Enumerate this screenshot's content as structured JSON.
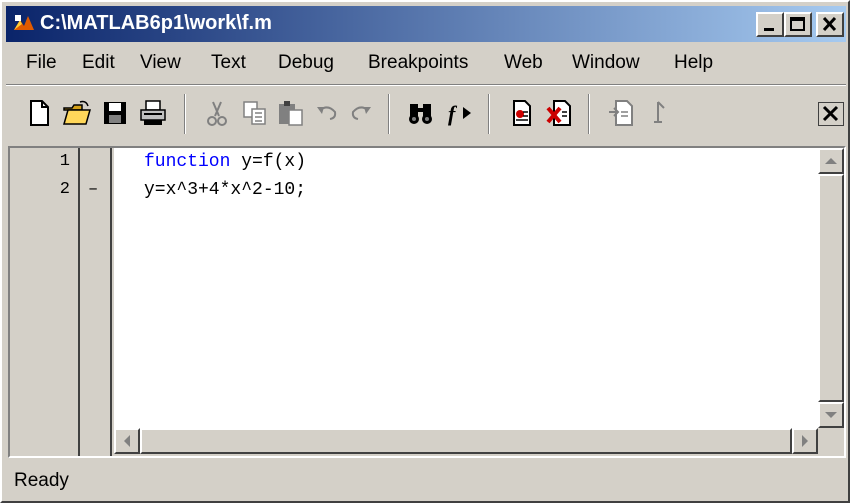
{
  "window": {
    "title": "C:\\MATLAB6p1\\work\\f.m"
  },
  "menu": {
    "items": [
      {
        "label": "File"
      },
      {
        "label": "Edit"
      },
      {
        "label": "View"
      },
      {
        "label": "Text"
      },
      {
        "label": "Debug"
      },
      {
        "label": "Breakpoints"
      },
      {
        "label": "Web"
      },
      {
        "label": "Window"
      },
      {
        "label": "Help"
      }
    ]
  },
  "toolbar": {
    "icons": [
      "new-file-icon",
      "open-folder-icon",
      "save-icon",
      "print-icon",
      "cut-icon",
      "copy-icon",
      "paste-icon",
      "undo-icon",
      "redo-icon",
      "find-icon",
      "function-list-icon",
      "set-breakpoint-icon",
      "clear-breakpoint-icon",
      "step-icon",
      "close-icon"
    ]
  },
  "editor": {
    "lines": [
      {
        "number": "1",
        "marker": "",
        "keyword": "function",
        "code": " y=f(x)"
      },
      {
        "number": "2",
        "marker": "–",
        "keyword": "",
        "code": "y=x^3+4*x^2-10;"
      }
    ]
  },
  "status": {
    "text": "Ready"
  },
  "colors": {
    "keyword": "#0000ff",
    "title_start": "#0a246a",
    "title_end": "#a6caf0",
    "face": "#d4d0c8"
  }
}
